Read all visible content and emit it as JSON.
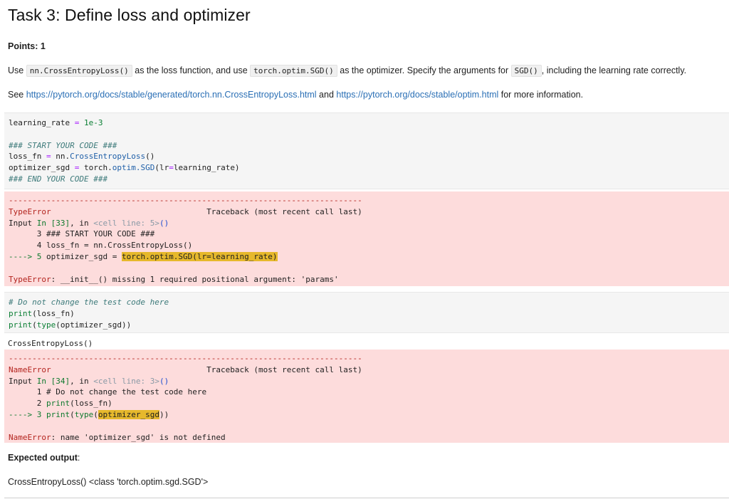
{
  "title": "Task 3: Define loss and optimizer",
  "points": "Points: 1",
  "instructions": {
    "p1_before": "Use ",
    "code1": "nn.CrossEntropyLoss()",
    "p1_mid1": " as the loss function, and use ",
    "code2": "torch.optim.SGD()",
    "p1_mid2": " as the optimizer. Specify the arguments for ",
    "code3": "SGD()",
    "p1_after": ", including the learning rate correctly.",
    "p2_before": "See ",
    "link1": "https://pytorch.org/docs/stable/generated/torch.nn.CrossEntropyLoss.html",
    "p2_mid": " and ",
    "link2": "https://pytorch.org/docs/stable/optim.html",
    "p2_after": " for more information."
  },
  "cell1": {
    "l1_var": "learning_rate",
    "l1_op": " = ",
    "l1_val": "1e-3",
    "l2": "### START YOUR CODE ###",
    "l3_a": "loss_fn",
    "l3_b": " = ",
    "l3_c": "nn.",
    "l3_d": "CrossEntropyLoss",
    "l3_e": "()",
    "l4_a": "optimizer_sgd",
    "l4_b": " = ",
    "l4_c": "torch.",
    "l4_d": "optim.",
    "l4_e": "SGD",
    "l4_f": "(lr",
    "l4_g": "=",
    "l4_h": "learning_rate)",
    "l5": "### END YOUR CODE ###"
  },
  "error1": {
    "dashes": "---------------------------------------------------------------------------",
    "type": "TypeError",
    "traceback": "Traceback (most recent call last)",
    "input_a": "Input ",
    "input_b": "In [33]",
    "input_c": ", in ",
    "input_d": "<cell line: 5>",
    "input_e": "()",
    "t1": "      3 ### START YOUR CODE ###",
    "t2": "      4 loss_fn = nn.CrossEntropyLoss()",
    "t3_arrow": "----> 5 ",
    "t3_a": "optimizer_sgd = ",
    "t3_hl": "torch.optim.SGD(lr=learning_rate)",
    "msg_type": "TypeError",
    "msg": ": __init__() missing 1 required positional argument: 'params'"
  },
  "cell2": {
    "l1": "# Do not change the test code here",
    "l2_a": "print",
    "l2_b": "(loss_fn)",
    "l3_a": "print",
    "l3_b": "(",
    "l3_c": "type",
    "l3_d": "(optimizer_sgd))"
  },
  "stdout2": "CrossEntropyLoss()",
  "error2": {
    "dashes": "---------------------------------------------------------------------------",
    "type": "NameError",
    "traceback": "Traceback (most recent call last)",
    "input_a": "Input ",
    "input_b": "In [34]",
    "input_c": ", in ",
    "input_d": "<cell line: 3>",
    "input_e": "()",
    "t1": "      1 # Do not change the test code here",
    "t2_a": "      2 ",
    "t2_b": "print",
    "t2_c": "(loss_fn)",
    "t3_arrow": "----> 3 ",
    "t3_a": "print",
    "t3_b": "(",
    "t3_c": "type",
    "t3_d": "(",
    "t3_hl": "optimizer_sgd",
    "t3_e": "))",
    "msg_type": "NameError",
    "msg": ": name 'optimizer_sgd' is not defined"
  },
  "expected_label": "Expected output",
  "expected_colon": ":",
  "expected_value": "CrossEntropyLoss() <class 'torch.optim.sgd.SGD'>"
}
